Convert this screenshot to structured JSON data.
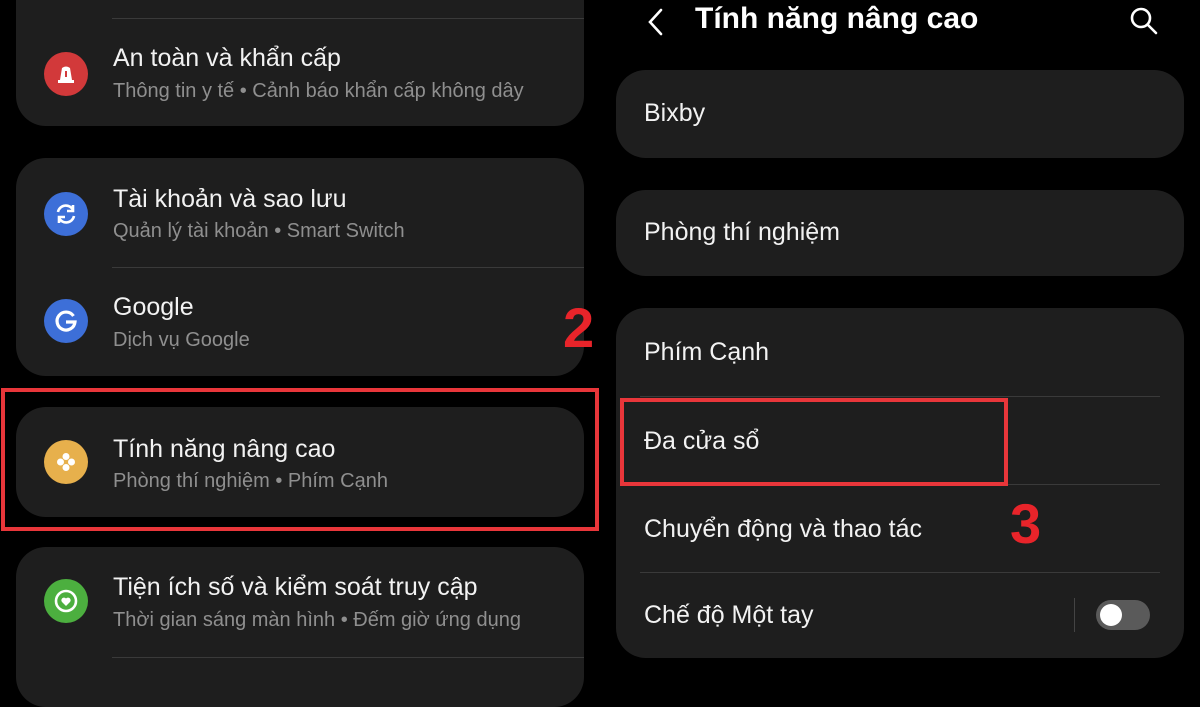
{
  "left_panel": {
    "items": [
      {
        "title": "An toàn và khẩn cấp",
        "subtitle": "Thông tin y tế  •  Cảnh báo khẩn cấp không dây",
        "icon": "siren-icon",
        "color": "#d2393a"
      },
      {
        "title": "Tài khoản và sao lưu",
        "subtitle": "Quản lý tài khoản  •  Smart Switch",
        "icon": "sync-icon",
        "color": "#3d6fd8"
      },
      {
        "title": "Google",
        "subtitle": "Dịch vụ Google",
        "icon": "google-icon",
        "color": "#3d6fd8"
      },
      {
        "title": "Tính năng nâng cao",
        "subtitle": "Phòng thí nghiệm  •  Phím Cạnh",
        "icon": "gear-flower-icon",
        "color": "#e7b04c"
      },
      {
        "title": "Tiện ích số và kiểm soát truy cập",
        "subtitle": "Thời gian sáng màn hình  •  Đếm giờ ứng dụng",
        "icon": "heart-ring-icon",
        "color": "#4caf3f"
      }
    ]
  },
  "right_panel": {
    "header": {
      "title": "Tính năng nâng cao",
      "back_icon": "back-chevron-icon",
      "search_icon": "search-icon"
    },
    "items": [
      {
        "title": "Bixby"
      },
      {
        "title": "Phòng thí nghiệm"
      },
      {
        "title": "Phím Cạnh"
      },
      {
        "title": "Đa cửa sổ"
      },
      {
        "title": "Chuyển động và thao tác"
      },
      {
        "title": "Chế độ Một tay",
        "toggle_on": false
      }
    ]
  },
  "annotations": {
    "step2": "2",
    "step3": "3",
    "highlight_color": "#e8363a"
  }
}
